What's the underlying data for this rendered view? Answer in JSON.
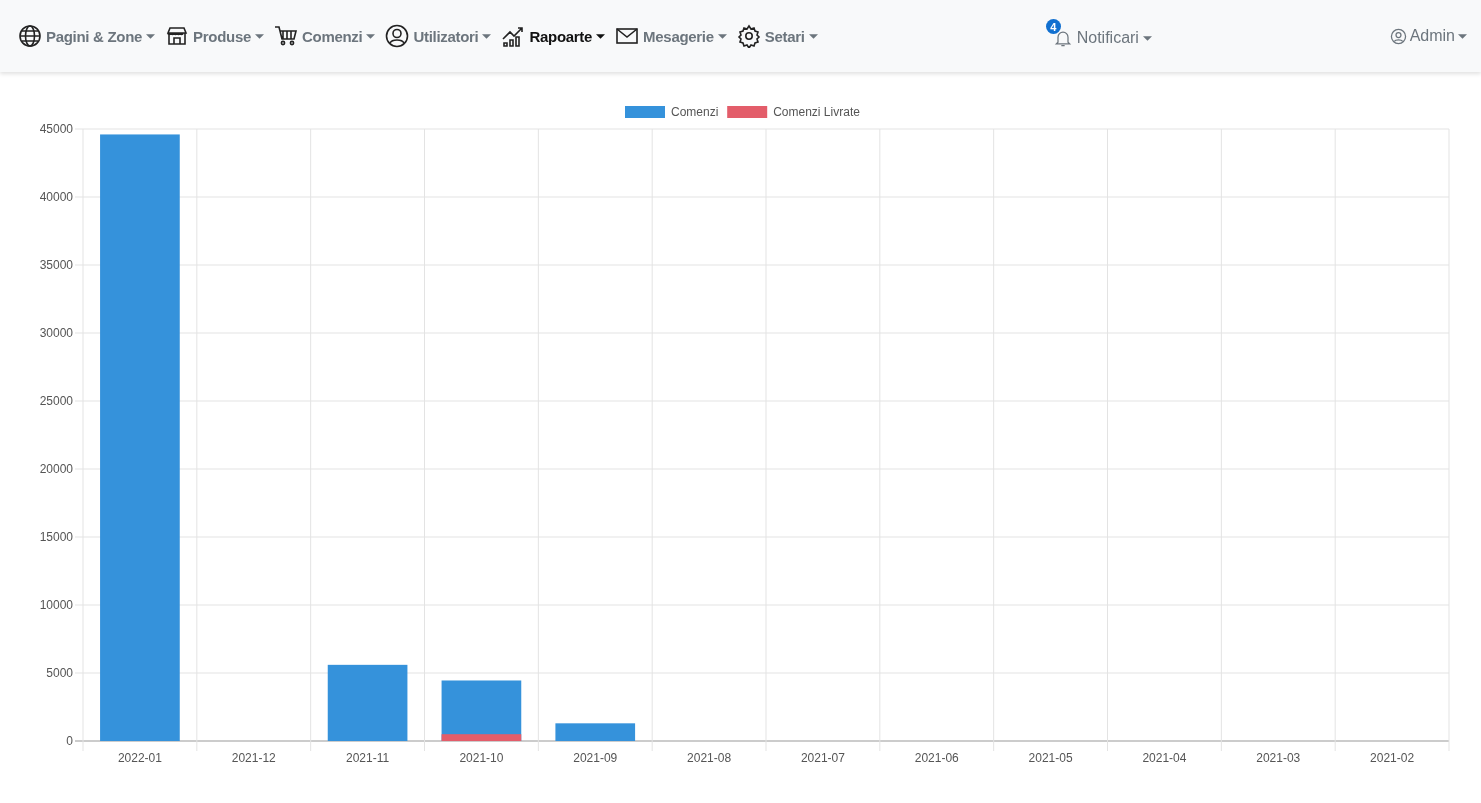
{
  "nav": {
    "items": [
      {
        "label": "Pagini & Zone",
        "selected": false
      },
      {
        "label": "Produse",
        "selected": false
      },
      {
        "label": "Comenzi",
        "selected": false
      },
      {
        "label": "Utilizatori",
        "selected": false
      },
      {
        "label": "Rapoarte",
        "selected": true
      },
      {
        "label": "Mesagerie",
        "selected": false
      },
      {
        "label": "Setari",
        "selected": false
      }
    ],
    "notifications": {
      "count": "4",
      "label": "Notificari"
    },
    "user": {
      "label": "Admin"
    }
  },
  "chart_data": {
    "type": "bar",
    "categories": [
      "2022-01",
      "2021-12",
      "2021-11",
      "2021-10",
      "2021-09",
      "2021-08",
      "2021-07",
      "2021-06",
      "2021-05",
      "2021-04",
      "2021-03",
      "2021-02"
    ],
    "series": [
      {
        "name": "Comenzi",
        "color": "#3592db",
        "values": [
          44600,
          0,
          5600,
          4450,
          1300,
          0,
          0,
          0,
          0,
          0,
          0,
          0
        ]
      },
      {
        "name": "Comenzi Livrate",
        "color": "#e35d6a",
        "values": [
          0,
          0,
          0,
          500,
          0,
          0,
          0,
          0,
          0,
          0,
          0,
          0
        ]
      }
    ],
    "legend": true,
    "grid": true,
    "ylim": [
      0,
      45000
    ],
    "yticks": [
      0,
      5000,
      10000,
      15000,
      20000,
      25000,
      30000,
      35000,
      40000,
      45000
    ]
  }
}
